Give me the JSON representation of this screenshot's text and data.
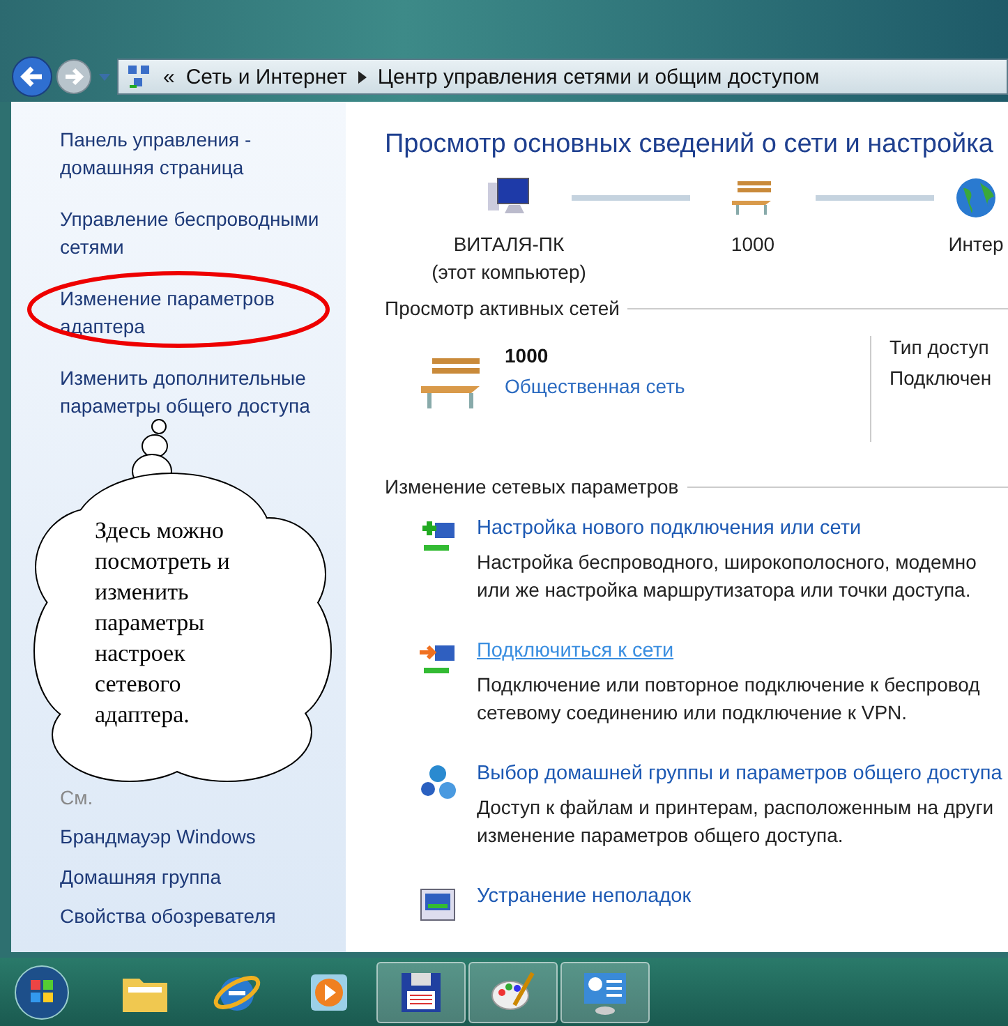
{
  "address_bar": {
    "prefix": "«",
    "crumbs": [
      "Сеть и Интернет",
      "Центр управления сетями и общим доступом"
    ]
  },
  "sidebar": {
    "items": [
      {
        "label": "Панель управления - домашняя страница"
      },
      {
        "label": "Управление беспроводными сетями"
      },
      {
        "label": "Изменение параметров адаптера"
      },
      {
        "label": "Изменить дополнительные параметры общего доступа"
      }
    ],
    "see_also": {
      "title": "См.",
      "items": [
        "Брандмауэр Windows",
        "Домашняя группа",
        "Свойства обозревателя"
      ]
    }
  },
  "annotation": {
    "text": "Здесь можно посмотреть и изменить параметры настроек сетевого адаптера."
  },
  "heading": "Просмотр основных сведений о сети и настройка",
  "network_map": [
    {
      "kind": "computer",
      "label": "ВИТАЛЯ-ПК",
      "sublabel": "(этот компьютер)"
    },
    {
      "kind": "network",
      "label": "1000"
    },
    {
      "kind": "internet",
      "label": "Интер"
    }
  ],
  "active_networks": {
    "title": "Просмотр активных сетей",
    "name": "1000",
    "type_link": "Общественная сеть",
    "details": [
      "Тип доступ",
      "Подключен"
    ]
  },
  "change_settings": {
    "title": "Изменение сетевых параметров",
    "tasks": [
      {
        "kind": "new",
        "title": "Настройка нового подключения или сети",
        "hovered": false,
        "description": [
          "Настройка беспроводного, широкополосного, модемно",
          "или же настройка маршрутизатора или точки доступа."
        ]
      },
      {
        "kind": "connect",
        "title": "Подключиться к сети",
        "hovered": true,
        "description": [
          "Подключение или повторное подключение к беспровод",
          "сетевому соединению или подключение к VPN."
        ]
      },
      {
        "kind": "homegroup",
        "title": "Выбор домашней группы и параметров общего доступа",
        "hovered": false,
        "description": [
          "Доступ к файлам и принтерам, расположенным на други",
          "изменение параметров общего доступа."
        ]
      },
      {
        "kind": "troubleshoot",
        "title": "Устранение неполадок",
        "hovered": false
      }
    ]
  },
  "taskbar": [
    {
      "kind": "folder",
      "running": false
    },
    {
      "kind": "browser",
      "running": false
    },
    {
      "kind": "media",
      "running": false
    },
    {
      "kind": "save",
      "running": true
    },
    {
      "kind": "paint",
      "running": true
    },
    {
      "kind": "control",
      "running": true
    }
  ]
}
